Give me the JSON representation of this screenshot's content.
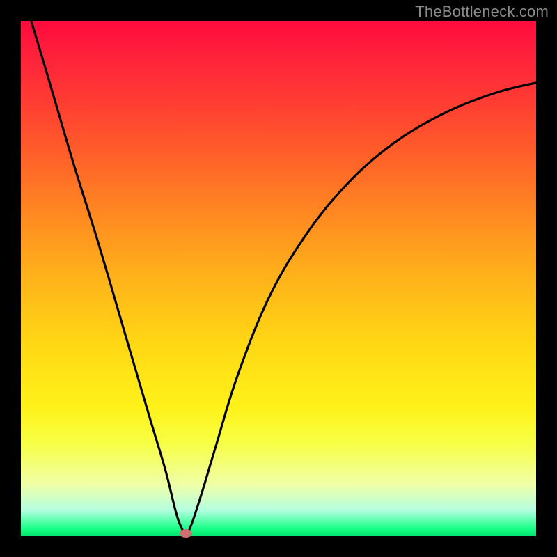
{
  "watermark": "TheBottleneck.com",
  "colors": {
    "frame": "#000000",
    "curve": "#000000",
    "dot": "#cf6f6f",
    "watermark": "#8b8b8b"
  },
  "chart_data": {
    "type": "line",
    "title": "",
    "xlabel": "",
    "ylabel": "",
    "xlim": [
      0,
      100
    ],
    "ylim": [
      0,
      100
    ],
    "grid": false,
    "legend": false,
    "series": [
      {
        "name": "bottleneck-curve",
        "x": [
          2,
          5,
          10,
          15,
          20,
          25,
          28,
          30,
          31,
          32,
          33,
          35,
          38,
          42,
          48,
          55,
          63,
          72,
          82,
          92,
          100
        ],
        "y": [
          100,
          90,
          73,
          57,
          40,
          23,
          13,
          5,
          2,
          0.5,
          2,
          8,
          18,
          31,
          46,
          58,
          68,
          76,
          82,
          86,
          88
        ]
      }
    ],
    "annotations": [
      {
        "name": "minimum-dot",
        "x": 32,
        "y": 0.5
      }
    ]
  }
}
